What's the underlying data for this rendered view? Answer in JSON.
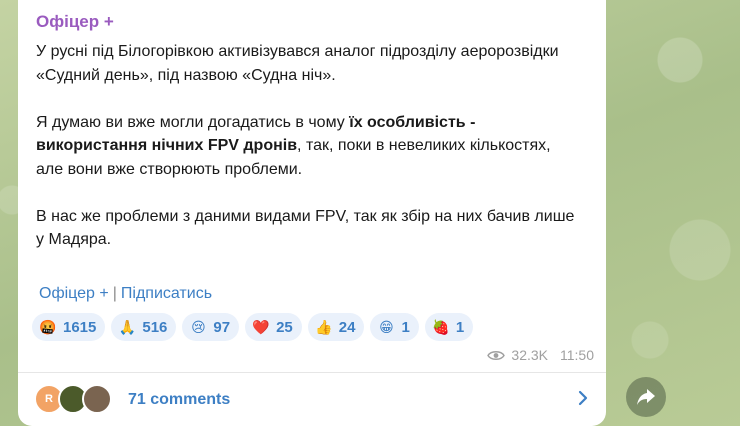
{
  "post": {
    "author": "Офіцер",
    "author_suffix": "+",
    "paragraph1": "У русні під Білогорівкою активізувався аналог підрозділу аеророзвідки «Судний день», під назвою «Судна ніч».",
    "paragraph2_a": "Я думаю ви вже могли догадатись в чому ",
    "paragraph2_bold": "їх особливість - використання нічних FPV дронів",
    "paragraph2_b": ", так, поки в невеликих кількостях, але вони вже створюють проблеми.",
    "paragraph3": "В нас же проблеми з даними видами FPV, так як збір на них бачив лише у Мадяра."
  },
  "signature": {
    "channel": "Офіцер +",
    "separator": "|",
    "subscribe": "Підписатись"
  },
  "reactions": [
    {
      "emoji": "🤬",
      "count": "1615",
      "color": "#e8553b"
    },
    {
      "emoji": "🙏",
      "count": "516",
      "color": "#f5c542"
    },
    {
      "emoji": "😢",
      "count": "97",
      "color": "#f5c542"
    },
    {
      "emoji": "❤️",
      "count": "25",
      "color": "#e02b3a"
    },
    {
      "emoji": "👍",
      "count": "24",
      "color": "#f5c542"
    },
    {
      "emoji": "😁",
      "count": "1",
      "color": "#f5c542"
    },
    {
      "emoji": "🍓",
      "count": "1",
      "color": "#d8283e"
    }
  ],
  "meta": {
    "views": "32.3K",
    "time": "11:50"
  },
  "comments": {
    "avatar_initial": "R",
    "label": "71 comments"
  },
  "icons": {
    "views": "eye-icon",
    "comments_arrow": "chevron-right-icon",
    "share": "share-icon"
  }
}
